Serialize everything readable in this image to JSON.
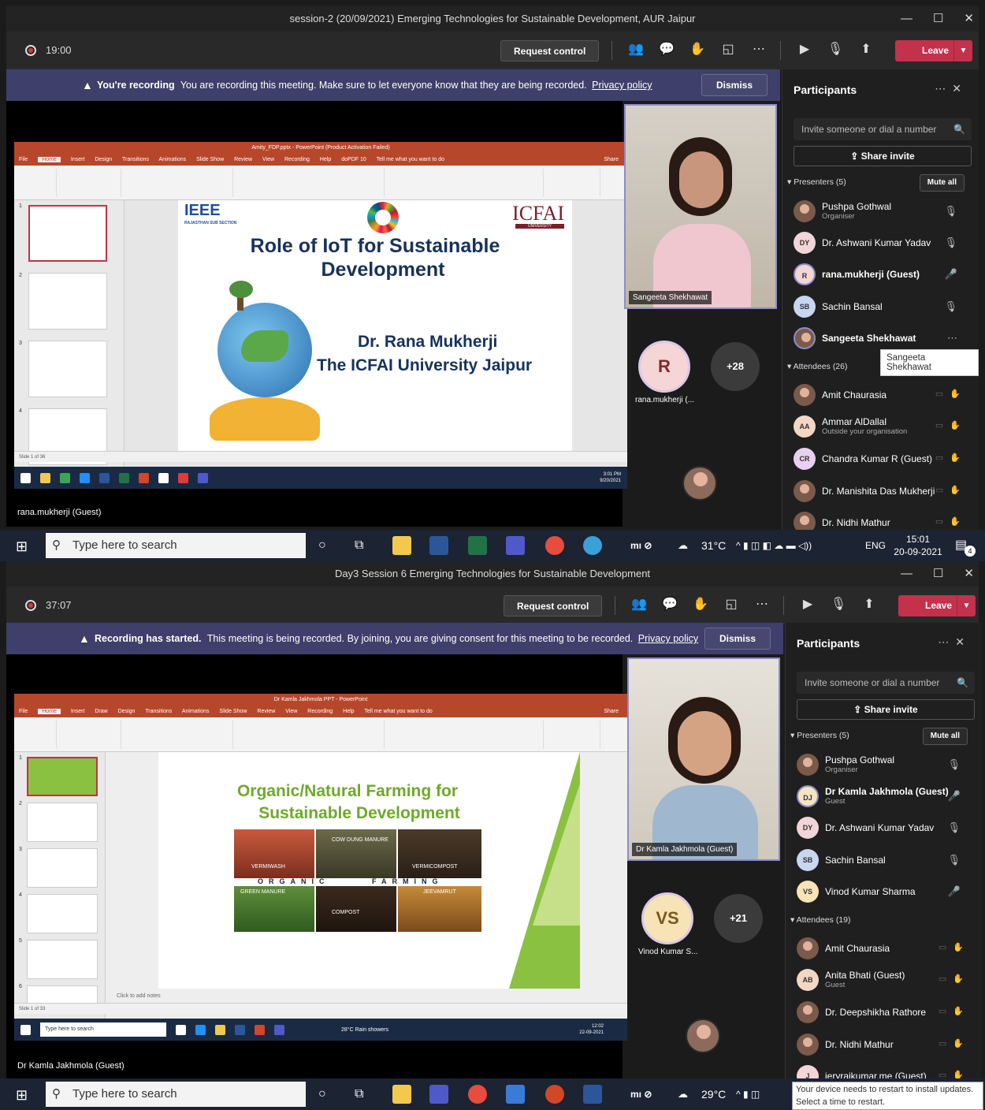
{
  "sessions": [
    {
      "title": "session-2 (20/09/2021) Emerging Technologies for Sustainable Development, AUR Jaipur",
      "timer": "19:00",
      "request_control": "Request control",
      "leave": "Leave",
      "banner_bold": "You're recording",
      "banner_text": "You are recording this meeting. Make sure to let everyone know that they are being recorded.",
      "privacy": "Privacy policy",
      "dismiss": "Dismiss",
      "presenter_label": "rana.mukherji (Guest)",
      "ppt": {
        "window_title": "Amity_FDP.pptx - PowerPoint (Product Activation Failed)",
        "tabs": [
          "File",
          "Home",
          "Insert",
          "Design",
          "Transitions",
          "Animations",
          "Slide Show",
          "Review",
          "View",
          "Recording",
          "Help",
          "doPDF 10",
          "Tell me what you want to do"
        ],
        "share": "Share",
        "status": "Slide 1 of 36",
        "slide_logo_left": "IEEE",
        "slide_logo_left_sub": "RAJASTHAN SUB SECTION",
        "slide_logo_right": "ICFAI",
        "slide_logo_right_sub": "UNIVERSITY",
        "slide_title_1": "Role of IoT for Sustainable",
        "slide_title_2": "Development",
        "slide_author_1": "Dr. Rana Mukherji",
        "slide_author_2": "The ICFAI University Jaipur",
        "clock": "3:01 PM",
        "date": "9/20/2021"
      },
      "video_tile_name": "Sangeeta Shekhawat",
      "avatar_letter": "R",
      "more_count": "+28",
      "avatar_caption": "rana.mukherji (...",
      "participants": {
        "title": "Participants",
        "invite_placeholder": "Invite someone or dial a number",
        "share_invite": "Share invite",
        "presenters_label": "Presenters (5)",
        "mute_all": "Mute all",
        "presenters": [
          {
            "name": "Pushpa Gothwal",
            "sub": "Organiser",
            "initials": ""
          },
          {
            "name": "Dr. Ashwani Kumar Yadav",
            "sub": "",
            "initials": "DY"
          },
          {
            "name": "rana.mukherji (Guest)",
            "sub": "",
            "initials": "R"
          },
          {
            "name": "Sachin Bansal",
            "sub": "",
            "initials": "SB"
          },
          {
            "name": "Sangeeta Shekhawat",
            "sub": "",
            "initials": ""
          }
        ],
        "attendees_label": "Attendees (26)",
        "attendees": [
          {
            "name": "Amit Chaurasia",
            "sub": "",
            "initials": ""
          },
          {
            "name": "Ammar AlDallal",
            "sub": "Outside your organisation",
            "initials": "AA"
          },
          {
            "name": "Chandra Kumar R (Guest)",
            "sub": "",
            "initials": "CR"
          },
          {
            "name": "Dr. Manishita Das Mukherji",
            "sub": "",
            "initials": ""
          },
          {
            "name": "Dr. Nidhi Mathur",
            "sub": "",
            "initials": ""
          }
        ],
        "tooltip": "Sangeeta Shekhawat"
      },
      "taskbar": {
        "search": "Type here to search",
        "temp": "31°C",
        "lang": "ENG",
        "time": "15:01",
        "date": "20-09-2021",
        "notif_count": "4"
      }
    },
    {
      "title": "Day3 Session 6 Emerging Technologies for Sustainable Development",
      "timer": "37:07",
      "request_control": "Request control",
      "leave": "Leave",
      "banner_bold": "Recording has started.",
      "banner_text": "This meeting is being recorded. By joining, you are giving consent for this meeting to be recorded.",
      "privacy": "Privacy policy",
      "dismiss": "Dismiss",
      "presenter_label": "Dr Kamla Jakhmola (Guest)",
      "ppt": {
        "window_title": "Dr Kamla Jakhmola PPT - PowerPoint",
        "tabs": [
          "File",
          "Home",
          "Insert",
          "Draw",
          "Design",
          "Transitions",
          "Animations",
          "Slide Show",
          "Review",
          "View",
          "Recording",
          "Help",
          "Tell me what you want to do"
        ],
        "share": "Share",
        "status": "Slide 1 of 33",
        "slide_title_1": "Organic/Natural Farming for",
        "slide_title_2": "Sustainable Development",
        "img_labels": [
          "VERMIWASH",
          "COW DUNG MANURE",
          "VERMICOMPOST",
          "GREEN MANURE",
          "COMPOST",
          "JEEVAMRUT"
        ],
        "organic": "ORGANIC",
        "farming": "FARMING",
        "notes": "Click to add notes",
        "mini_search": "Type here to search",
        "weather": "28°C Rain showers",
        "clock": "12:02",
        "date": "22-09-2021"
      },
      "video_tile_name": "Dr Kamla Jakhmola (Guest)",
      "avatar_letter": "VS",
      "more_count": "+21",
      "avatar_caption": "Vinod Kumar S...",
      "participants": {
        "title": "Participants",
        "invite_placeholder": "Invite someone or dial a number",
        "share_invite": "Share invite",
        "presenters_label": "Presenters (5)",
        "mute_all": "Mute all",
        "presenters": [
          {
            "name": "Pushpa Gothwal",
            "sub": "Organiser",
            "initials": ""
          },
          {
            "name": "Dr Kamla Jakhmola (Guest)",
            "sub": "Guest",
            "initials": "DJ"
          },
          {
            "name": "Dr. Ashwani Kumar Yadav",
            "sub": "",
            "initials": "DY"
          },
          {
            "name": "Sachin Bansal",
            "sub": "",
            "initials": "SB"
          },
          {
            "name": "Vinod Kumar Sharma",
            "sub": "",
            "initials": "VS"
          }
        ],
        "attendees_label": "Attendees (19)",
        "attendees": [
          {
            "name": "Amit Chaurasia",
            "sub": "",
            "initials": ""
          },
          {
            "name": "Anita Bhati (Guest)",
            "sub": "Guest",
            "initials": "AB"
          },
          {
            "name": "Dr. Deepshikha Rathore",
            "sub": "",
            "initials": ""
          },
          {
            "name": "Dr. Nidhi Mathur",
            "sub": "",
            "initials": ""
          },
          {
            "name": "jeryrajkumar.me (Guest)",
            "sub": "",
            "initials": "J"
          }
        ]
      },
      "taskbar": {
        "search": "Type here to search",
        "temp": "29°C"
      },
      "notification_1": "Your device needs to restart to install updates.",
      "notification_2": "Select a time to restart."
    }
  ],
  "colors": {
    "teams_dark": "#1b1b1b",
    "banner": "#3e3f6a",
    "leave_red": "#c4314b",
    "ppt_red": "#b7472a",
    "accent_purple": "#8b8cc7"
  }
}
